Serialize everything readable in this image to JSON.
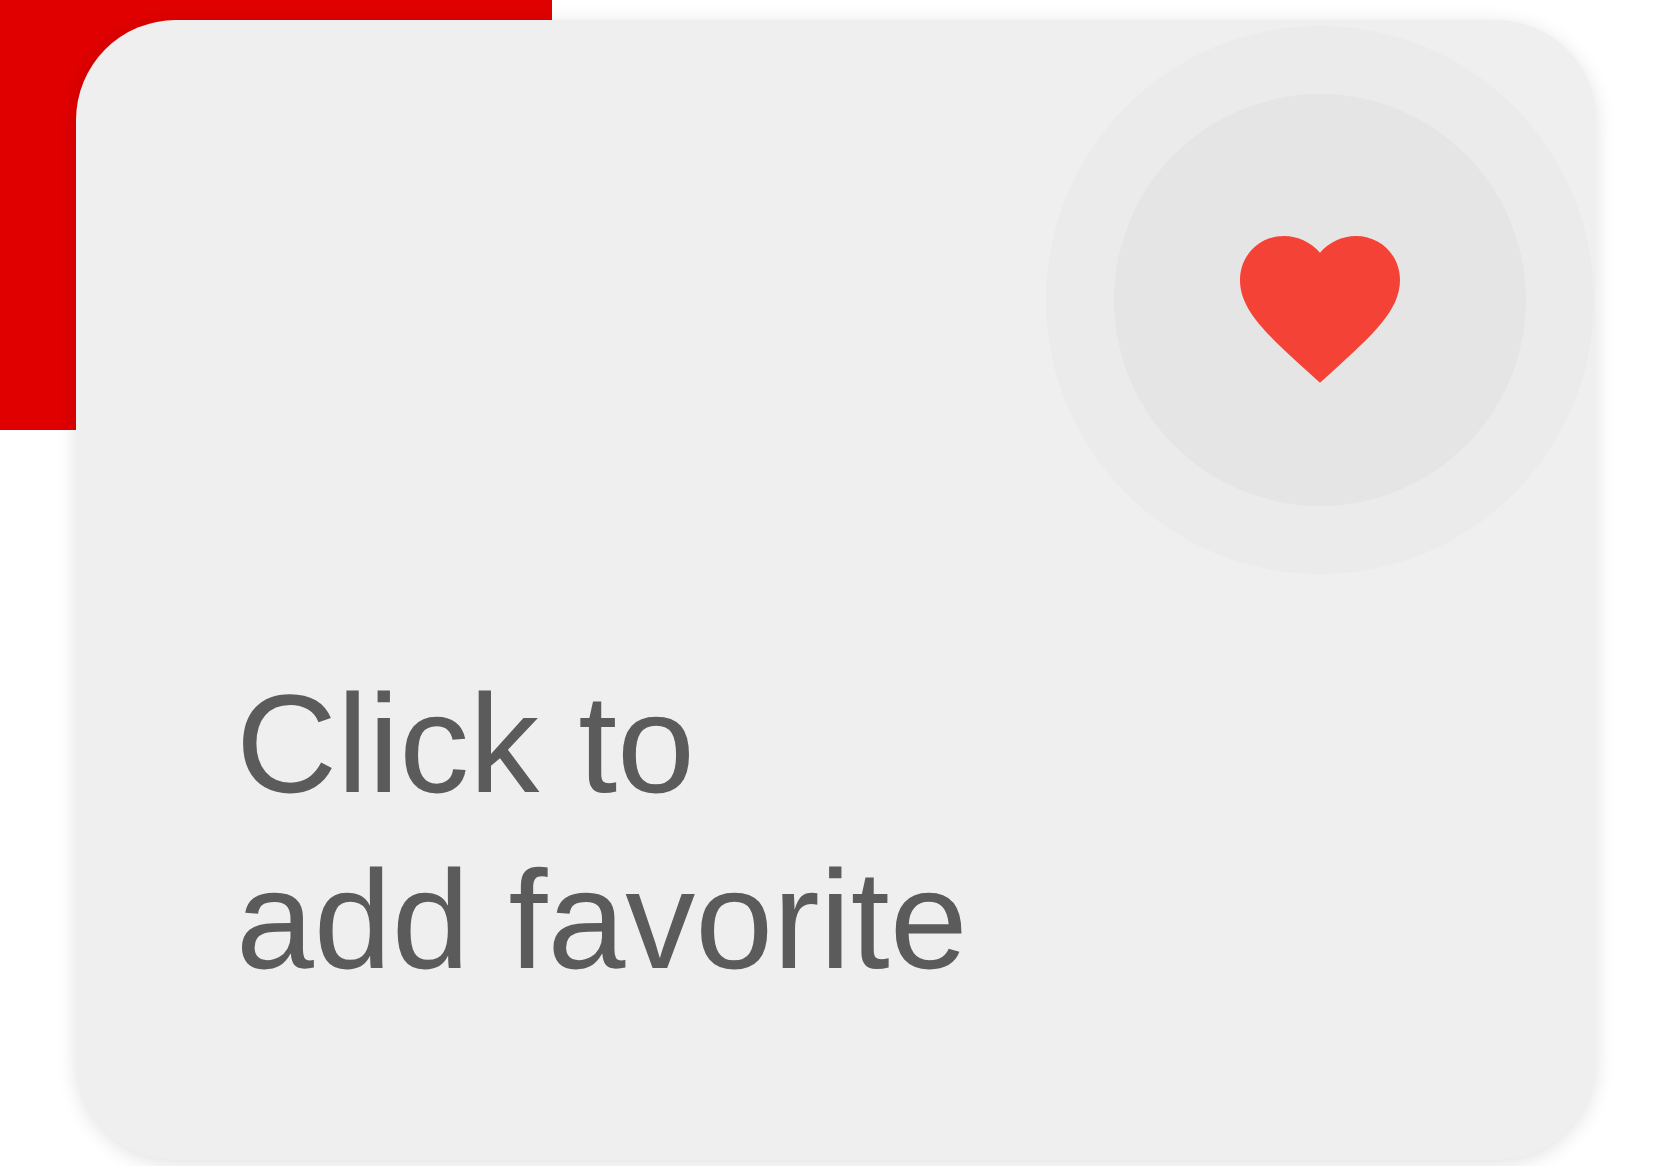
{
  "card": {
    "label": "Click to\nadd favorite"
  }
}
